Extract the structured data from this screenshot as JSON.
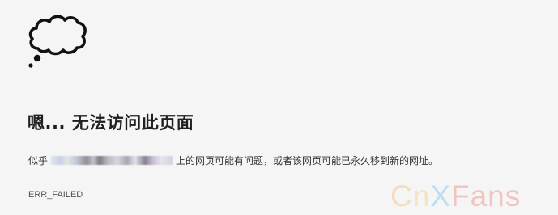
{
  "error_page": {
    "headline": "嗯... 无法访问此页面",
    "message_prefix": "似乎",
    "message_suffix": "上的网页可能有问题，或者该网页可能已永久移到新的网址。",
    "error_code": "ERR_FAILED",
    "icon": "cloud-thought-icon"
  },
  "watermark": {
    "c": "C",
    "n": "n",
    "x": "X",
    "fans": "Fans"
  }
}
